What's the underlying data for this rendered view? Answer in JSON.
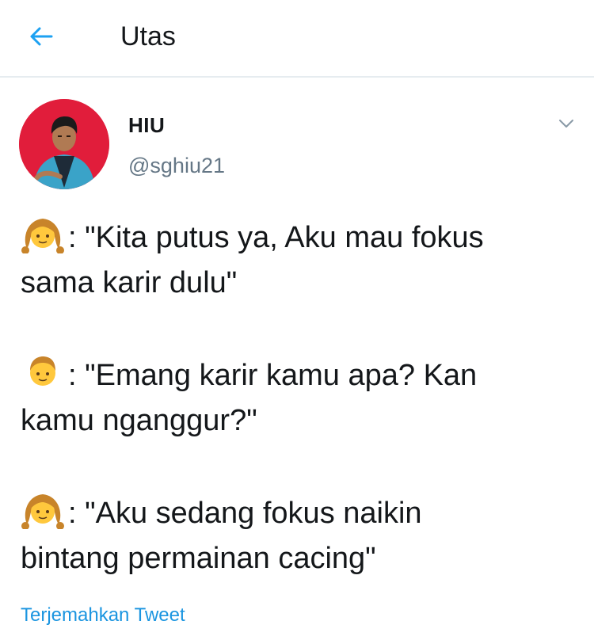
{
  "header": {
    "title": "Utas",
    "back_icon": "arrow-left-icon",
    "accent_color": "#1da1f2"
  },
  "tweet": {
    "author": {
      "name": "HIU",
      "handle": "@sghiu21",
      "avatar_bg": "#e11d3b"
    },
    "menu_icon": "chevron-down-icon",
    "lines": [
      {
        "emoji": "girl-emoji",
        "text": ": \"Kita putus ya, Aku mau fokus"
      },
      {
        "text": "sama karir dulu\""
      },
      {
        "emoji": "boy-emoji",
        "text": ": \"Emang karir kamu apa? Kan"
      },
      {
        "text": "kamu nganggur?\""
      },
      {
        "emoji": "girl-emoji",
        "text": ": \"Aku sedang fokus naikin"
      },
      {
        "text": "bintang permainan cacing\""
      }
    ],
    "translate_link": "Terjemahkan Tweet",
    "translate_color": "#1b95e0"
  }
}
